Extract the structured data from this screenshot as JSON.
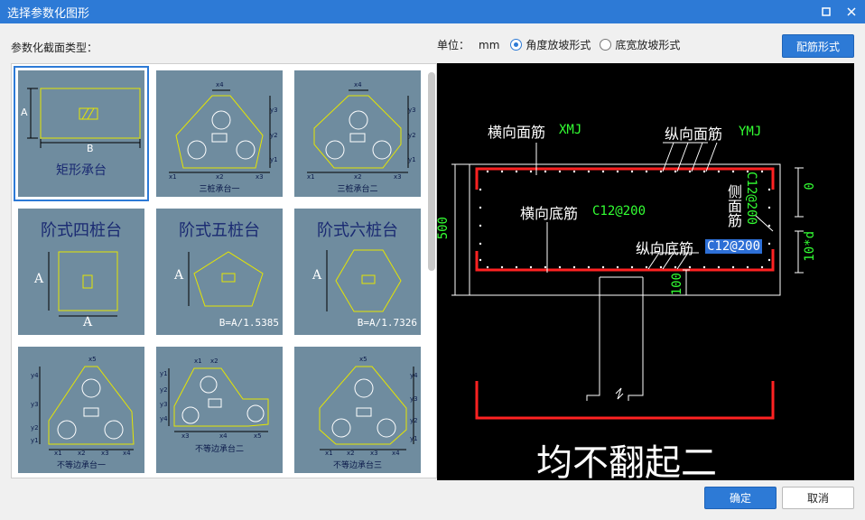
{
  "window": {
    "title": "选择参数化图形",
    "maximize_icon": "square-icon",
    "close_icon": "close-icon"
  },
  "section_label": "参数化截面类型：",
  "unit": {
    "label": "单位：",
    "value": "mm"
  },
  "slope_options": [
    {
      "label": "角度放坡形式",
      "selected": true
    },
    {
      "label": "底宽放坡形式",
      "selected": false
    }
  ],
  "buttons": {
    "rebar_style": "配筋形式",
    "ok": "确定",
    "cancel": "取消"
  },
  "tiles": {
    "t1": {
      "caption": "矩形承台",
      "dim_a": "A",
      "dim_b": "B"
    },
    "t2": {
      "caption": "三桩承台一",
      "x4": "x4",
      "y3": "y3",
      "y2": "y2",
      "y1": "y1",
      "x1": "x1",
      "x2": "x2",
      "x3": "x3"
    },
    "t3": {
      "caption": "三桩承台二",
      "x4": "x4",
      "y3": "y3",
      "y2": "y2",
      "y1": "y1",
      "x1": "x1",
      "x2": "x2",
      "x3": "x3"
    },
    "t4": {
      "title": "阶式四桩台",
      "dim_a_left": "A",
      "dim_a_bottom": "A"
    },
    "t5": {
      "title": "阶式五桩台",
      "dim_a": "A",
      "formula": "B=A/1.5385"
    },
    "t6": {
      "title": "阶式六桩台",
      "dim_a": "A",
      "formula": "B=A/1.7326"
    },
    "t7": {
      "caption": "不等边承台一",
      "x1": "x1",
      "x2": "x2",
      "x3": "x3",
      "x4": "x4",
      "x5": "x5",
      "y1": "y1",
      "y2": "y2",
      "y3": "y3",
      "y4": "y4"
    },
    "t8": {
      "caption": "不等边承台二",
      "x1": "x1",
      "x2": "x2",
      "x3": "x3",
      "x4": "x4",
      "x5": "x5",
      "y1": "y1",
      "y2": "y2",
      "y3": "y3",
      "y4": "y4"
    },
    "t9": {
      "caption": "不等边承台三",
      "x1": "x1",
      "x2": "x2",
      "x3": "x3",
      "x4": "x4",
      "x5": "x5",
      "y1": "y1",
      "y2": "y2",
      "y3": "y3",
      "y4": "y4"
    }
  },
  "preview": {
    "top_transverse_label": "横向面筋",
    "top_transverse_code": "XMJ",
    "top_longitudinal_label": "纵向面筋",
    "top_longitudinal_code": "YMJ",
    "bottom_transverse_label": "横向底筋",
    "bottom_transverse_code": "C12@200",
    "bottom_longitudinal_label": "纵向底筋",
    "bottom_longitudinal_code": "C12@200",
    "side_label": "侧面筋",
    "side_code": "C12@200",
    "height_dim": "500",
    "cover_dim": "100",
    "top_offset_dim": "0",
    "anchor_dim": "10*d",
    "footer_text": "均不翻起二",
    "colors": {
      "background": "#000000",
      "rebar": "#ff2222",
      "text": "#ffffff",
      "code": "#33ff33",
      "highlight": "#2d6fd6"
    }
  }
}
